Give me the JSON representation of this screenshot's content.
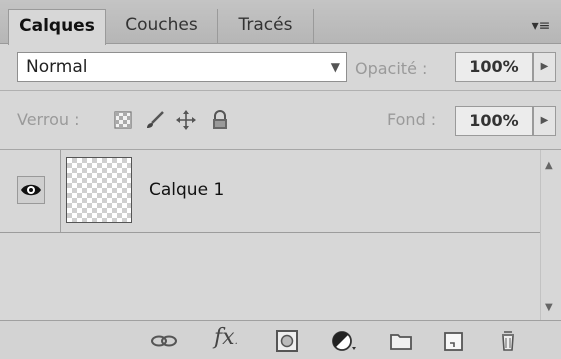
{
  "tabs": [
    {
      "label": "Calques",
      "active": true
    },
    {
      "label": "Couches",
      "active": false
    },
    {
      "label": "Tracés",
      "active": false
    }
  ],
  "blend": {
    "mode": "Normal",
    "opacity_label": "Opacité :",
    "opacity_value": "100%"
  },
  "lock": {
    "label": "Verrou :",
    "fill_label": "Fond :",
    "fill_value": "100%"
  },
  "layers": [
    {
      "name": "Calque 1",
      "visible": true
    }
  ],
  "icons": {
    "panel_menu": "panel-menu-icon",
    "lock": [
      "lock-transparency-icon",
      "lock-paint-icon",
      "lock-position-icon",
      "lock-all-icon"
    ],
    "toolbar": [
      "link-layers-icon",
      "fx-icon",
      "add-mask-icon",
      "adjustment-layer-icon",
      "new-group-icon",
      "new-layer-icon",
      "trash-icon"
    ]
  }
}
